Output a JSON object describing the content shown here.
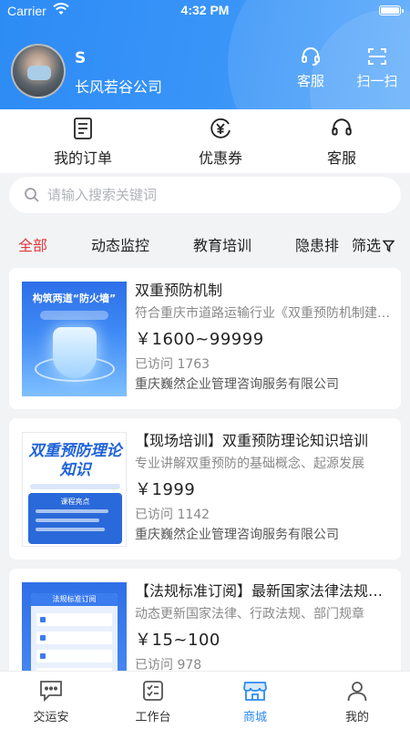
{
  "status_bar": {
    "carrier": "Carrier",
    "time": "4:32 PM"
  },
  "header": {
    "user_name": "S",
    "company": "长风若谷公司",
    "customer_service": "客服",
    "scan": "扫一扫"
  },
  "quick_menu": [
    {
      "label": "我的订单",
      "icon": "order-icon"
    },
    {
      "label": "优惠券",
      "icon": "coupon-icon"
    },
    {
      "label": "客服",
      "icon": "headset-icon"
    }
  ],
  "search": {
    "placeholder": "请输入搜索关键词"
  },
  "tabs": [
    {
      "label": "全部",
      "active": true
    },
    {
      "label": "动态监控",
      "active": false
    },
    {
      "label": "教育培训",
      "active": false
    },
    {
      "label": "隐患排",
      "active": false
    }
  ],
  "filter_label": "筛选",
  "products": [
    {
      "title": "双重预防机制",
      "desc": "符合重庆市道路运输行业《双重预防机制建设》",
      "price": "￥1600~99999",
      "visits": "已访问 1763",
      "seller": "重庆巍然企业管理咨询服务有限公司",
      "thumb": {
        "title": "构筑两道“防火墙”"
      }
    },
    {
      "title": "【现场培训】双重预防理论知识培训",
      "desc": "专业讲解双重预防的基础概念、起源发展",
      "price": "￥1999",
      "visits": "已访问 1142",
      "seller": "重庆巍然企业管理咨询服务有限公司",
      "thumb": {
        "title": "双重预防理论知识",
        "panel": "课程亮点"
      }
    },
    {
      "title": "【法规标准订阅】最新国家法律法规标准",
      "desc": "动态更新国家法律、行政法规、部门规章",
      "price": "￥15~100",
      "visits": "已访问 978",
      "seller": "",
      "thumb": {
        "title": "法规标准订阅"
      }
    }
  ],
  "bottom_nav": [
    {
      "label": "交运安",
      "icon": "chat-icon",
      "active": false
    },
    {
      "label": "工作台",
      "icon": "checklist-icon",
      "active": false
    },
    {
      "label": "商城",
      "icon": "store-icon",
      "active": true
    },
    {
      "label": "我的",
      "icon": "user-icon",
      "active": false
    }
  ],
  "colors": {
    "primary": "#2d8bf5",
    "active_tab": "#e0383a",
    "background": "#f2f3f5"
  }
}
